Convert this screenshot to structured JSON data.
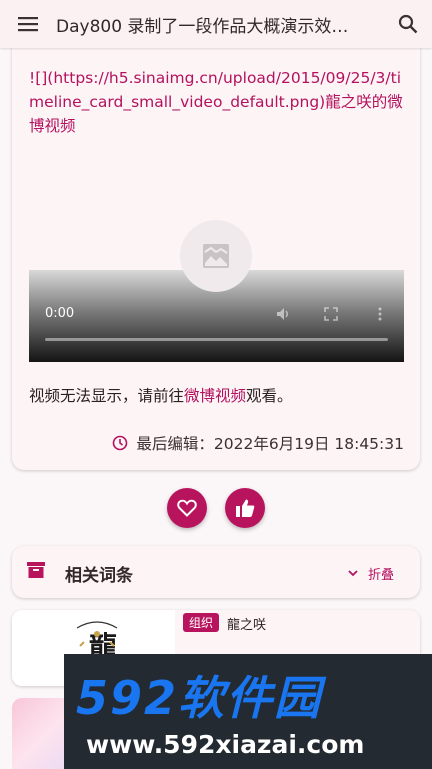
{
  "appbar": {
    "title": "Day800 录制了一段作品大概演示效…",
    "menu_icon": "menu-icon",
    "search_icon": "search-icon"
  },
  "post": {
    "markdown_link": "![](https://h5.sinaimg.cn/upload/2015/09/25/3/timeline_card_small_video_default.png)龍之咲的微博视频",
    "video": {
      "time": "0:00"
    },
    "notice_prefix": "视频无法显示，请前往",
    "notice_link": "微博视频",
    "notice_suffix": "观看。",
    "edited_label": "最后编辑：2022年6月19日 18:45:31"
  },
  "actions": {
    "favorite_icon": "heart-icon",
    "like_icon": "thumb-up-icon"
  },
  "related": {
    "title": "相关词条",
    "fold_label": "折叠",
    "entries": [
      {
        "tag": "组织",
        "name": "龍之咲"
      }
    ]
  },
  "watermark": {
    "brand": "592软件园",
    "url": "www.592xiazai.com"
  },
  "colors": {
    "accent": "#b8145e",
    "link": "#b4125e",
    "surface": "#fdf4f6",
    "background": "#fbf6f8"
  }
}
